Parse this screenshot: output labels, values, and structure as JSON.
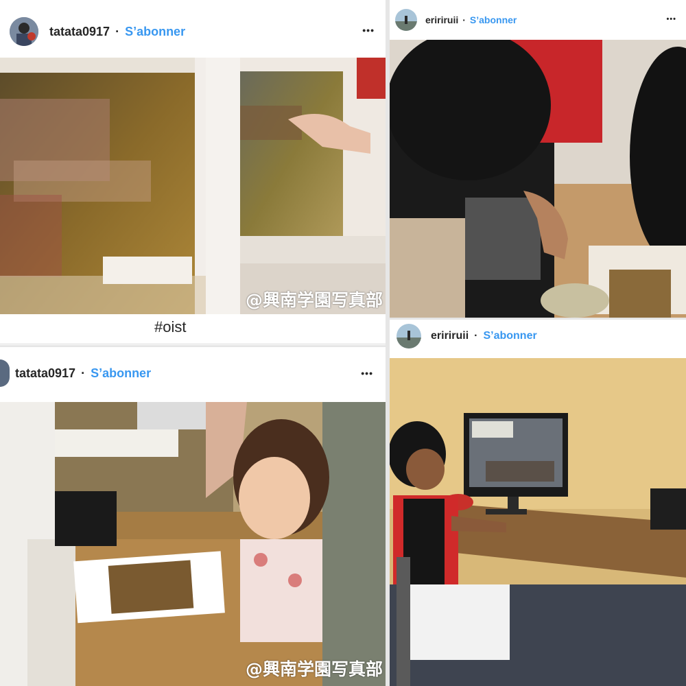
{
  "posts": [
    {
      "username": "tatata0917",
      "separator": "·",
      "follow_label": "S’abonner",
      "more_label": "•••",
      "watermark": "@興南学園写真部",
      "caption": "#oist"
    },
    {
      "username": "eririruii",
      "separator": "·",
      "follow_label": "S’abonner",
      "more_label": "•••"
    },
    {
      "username": "tatata0917",
      "separator": "·",
      "follow_label": "S’abonner",
      "more_label": "•••",
      "watermark": "@興南学園写真部"
    },
    {
      "username": "eririruii",
      "separator": "·",
      "follow_label": "S’abonner"
    }
  ],
  "colors": {
    "follow": "#3897f0",
    "text": "#262626",
    "divider": "#dbdbdb"
  },
  "icons": {
    "more": "more-options-icon",
    "avatar": "user-avatar"
  }
}
